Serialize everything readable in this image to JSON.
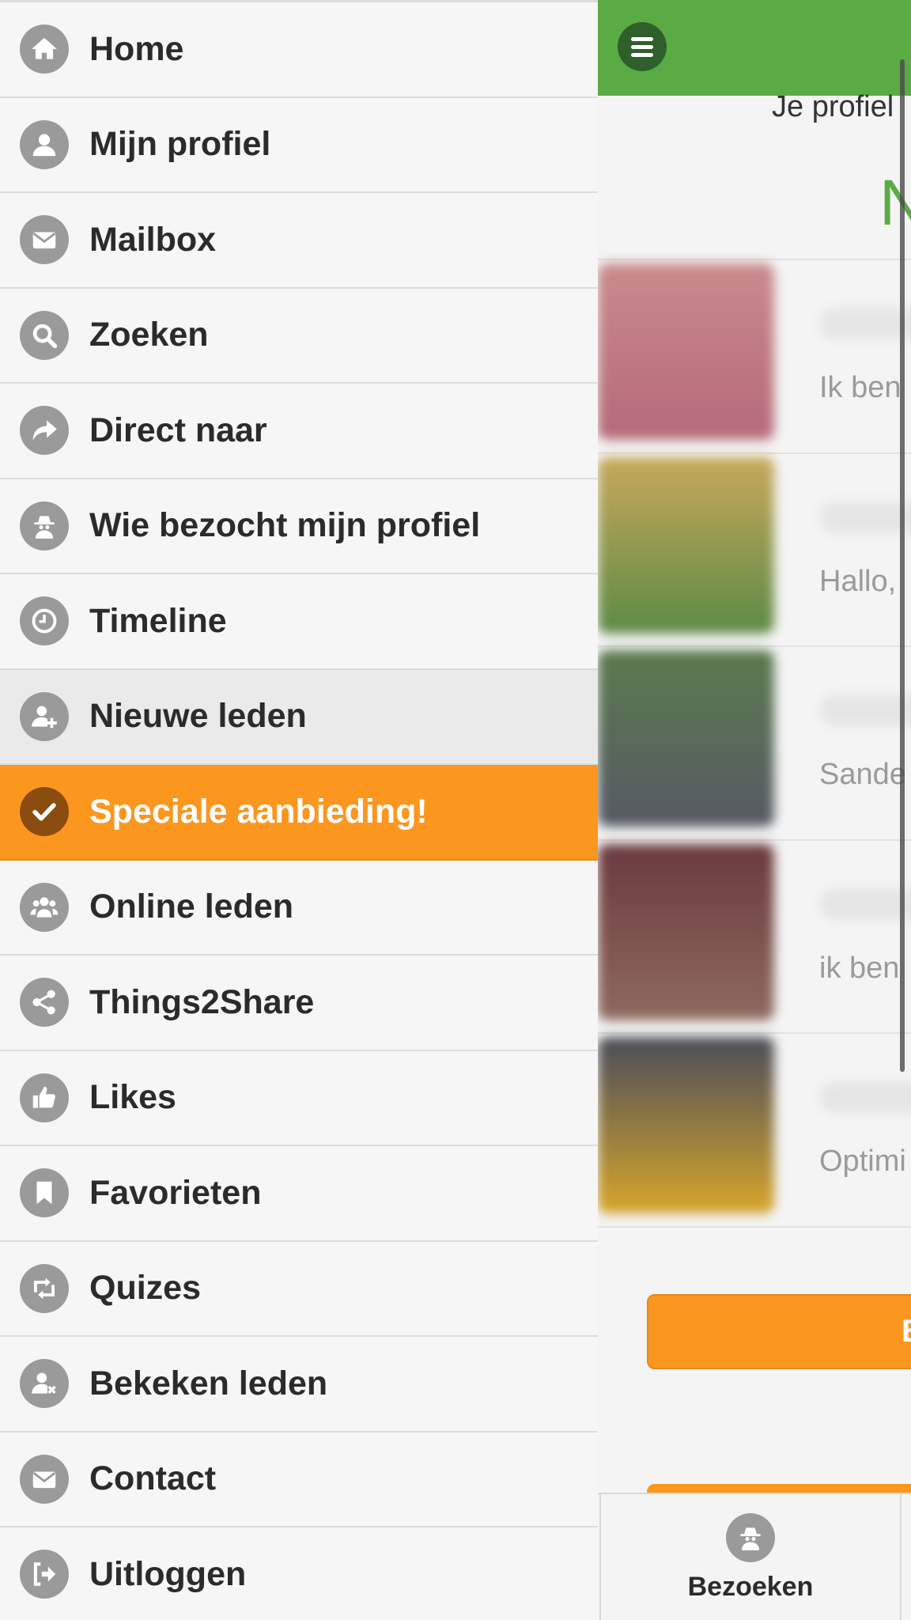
{
  "menu": {
    "items": [
      {
        "label": "Home",
        "icon": "home-icon"
      },
      {
        "label": "Mijn profiel",
        "icon": "user-icon"
      },
      {
        "label": "Mailbox",
        "icon": "envelope-icon"
      },
      {
        "label": "Zoeken",
        "icon": "search-icon"
      },
      {
        "label": "Direct naar",
        "icon": "share-arrow-icon"
      },
      {
        "label": "Wie bezocht mijn profiel",
        "icon": "spy-icon"
      },
      {
        "label": "Timeline",
        "icon": "clock-icon"
      },
      {
        "label": "Nieuwe leden",
        "icon": "user-plus-icon"
      },
      {
        "label": "Speciale aanbieding!",
        "icon": "check-icon"
      },
      {
        "label": "Online leden",
        "icon": "users-icon"
      },
      {
        "label": "Things2Share",
        "icon": "share-nodes-icon"
      },
      {
        "label": "Likes",
        "icon": "thumbs-up-icon"
      },
      {
        "label": "Favorieten",
        "icon": "bookmark-icon"
      },
      {
        "label": "Quizes",
        "icon": "retweet-icon"
      },
      {
        "label": "Bekeken leden",
        "icon": "user-remove-icon"
      },
      {
        "label": "Contact",
        "icon": "envelope-icon"
      },
      {
        "label": "Uitloggen",
        "icon": "sign-out-icon"
      }
    ]
  },
  "header": {
    "menu_icon": "hamburger-icon"
  },
  "main": {
    "profile_text": "Je profiel",
    "section_letter": "N",
    "members": [
      {
        "message": "Ik ben",
        "photo_color_top": "#c98a8c",
        "photo_color_bottom": "#b56a7a"
      },
      {
        "message": "Hallo,",
        "photo_color_top": "#c7a85a",
        "photo_color_bottom": "#5d8a45"
      },
      {
        "message": "Sande",
        "photo_color_top": "#5b7a4e",
        "photo_color_bottom": "#565a64"
      },
      {
        "message": "ik ben",
        "photo_color_top": "#6b3a3e",
        "photo_color_bottom": "#8e6a5e"
      },
      {
        "message": "Optimi",
        "photo_color_top": "#4a4d5a",
        "photo_color_bottom": "#d6a52a"
      }
    ],
    "cta_label": "B"
  },
  "bottom_bar": {
    "tab_label": "Bezoeken",
    "tab_icon": "spy-icon"
  },
  "colors": {
    "green": "#5aab44",
    "orange": "#fb961f",
    "icon_gray": "#9a9a9a",
    "text": "#2b2b2b"
  }
}
